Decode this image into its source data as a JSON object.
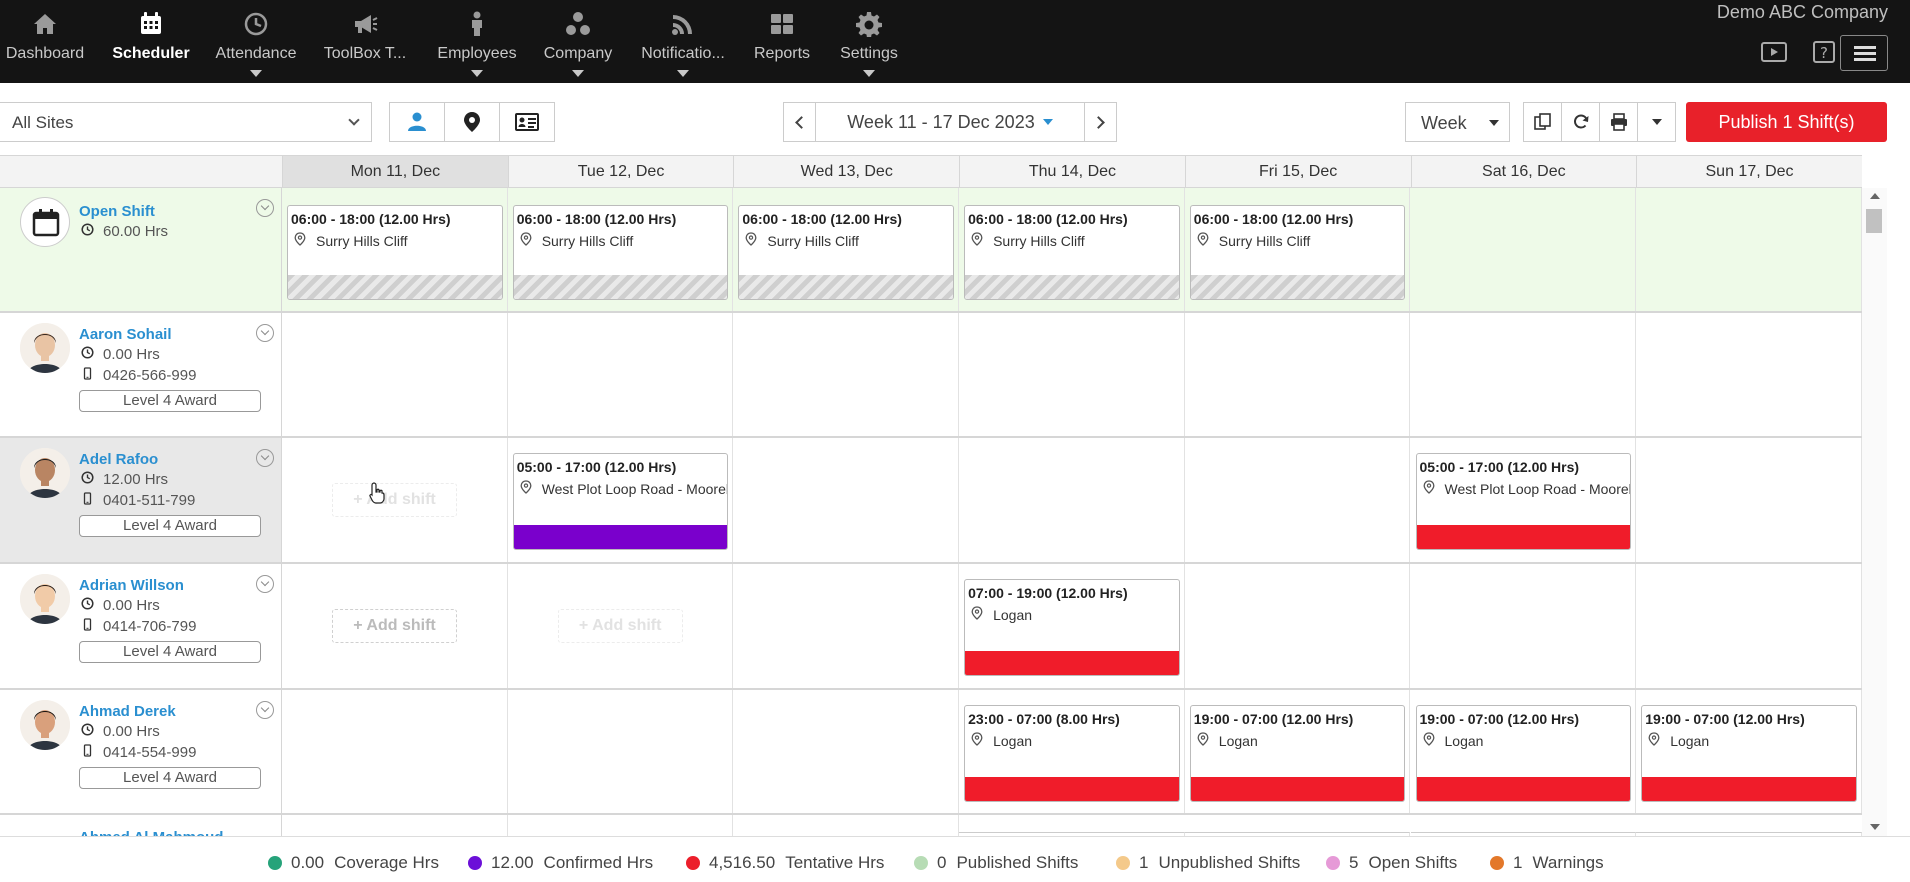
{
  "company_name": "Demo ABC Company",
  "nav": [
    {
      "label": "Dashboard",
      "icon": "home-icon",
      "active": false,
      "dropdown": false
    },
    {
      "label": "Scheduler",
      "icon": "calendar-icon",
      "active": true,
      "dropdown": false
    },
    {
      "label": "Attendance",
      "icon": "clock-icon",
      "active": false,
      "dropdown": true
    },
    {
      "label": "ToolBox T...",
      "icon": "megaphone-icon",
      "active": false,
      "dropdown": false
    },
    {
      "label": "Employees",
      "icon": "person-icon",
      "active": false,
      "dropdown": true
    },
    {
      "label": "Company",
      "icon": "group-icon",
      "active": false,
      "dropdown": true
    },
    {
      "label": "Notificatio...",
      "icon": "rss-icon",
      "active": false,
      "dropdown": true
    },
    {
      "label": "Reports",
      "icon": "grid-icon",
      "active": false,
      "dropdown": false
    },
    {
      "label": "Settings",
      "icon": "gear-icon",
      "active": false,
      "dropdown": true
    }
  ],
  "toolbar": {
    "site_filter": "All Sites",
    "week_range": "Week 11 - 17 Dec 2023",
    "view_mode": "Week",
    "publish_label": "Publish 1 Shift(s)"
  },
  "days": [
    {
      "label": "Mon 11, Dec",
      "today": true
    },
    {
      "label": "Tue 12, Dec",
      "today": false
    },
    {
      "label": "Wed 13, Dec",
      "today": false
    },
    {
      "label": "Thu 14, Dec",
      "today": false
    },
    {
      "label": "Fri 15, Dec",
      "today": false
    },
    {
      "label": "Sat 16, Dec",
      "today": false
    },
    {
      "label": "Sun 17, Dec",
      "today": false
    }
  ],
  "open_shift": {
    "name": "Open Shift",
    "hours": "60.00 Hrs",
    "shifts": [
      {
        "day": 0,
        "time": "06:00 - 18:00 (12.00 Hrs)",
        "location": "Surry Hills Cliff"
      },
      {
        "day": 1,
        "time": "06:00 - 18:00 (12.00 Hrs)",
        "location": "Surry Hills Cliff"
      },
      {
        "day": 2,
        "time": "06:00 - 18:00 (12.00 Hrs)",
        "location": "Surry Hills Cliff"
      },
      {
        "day": 3,
        "time": "06:00 - 18:00 (12.00 Hrs)",
        "location": "Surry Hills Cliff"
      },
      {
        "day": 4,
        "time": "06:00 - 18:00 (12.00 Hrs)",
        "location": "Surry Hills Cliff"
      }
    ]
  },
  "employees": [
    {
      "name": "Aaron Sohail",
      "hours": "0.00 Hrs",
      "phone": "0426-566-999",
      "award": "Level 4 Award",
      "skin": "#e9c4a4",
      "hair": "#3b2a20",
      "shifts": [],
      "add_shift": []
    },
    {
      "name": "Adel Rafoo",
      "hours": "12.00 Hrs",
      "phone": "0401-511-799",
      "award": "Level 4 Award",
      "skin": "#b98563",
      "hair": "#1d1d1d",
      "highlight": true,
      "shifts": [
        {
          "day": 1,
          "time": "05:00 - 17:00 (12.00 Hrs)",
          "location": "West Plot Loop Road - Moorebank",
          "color": "#7a00cc"
        },
        {
          "day": 5,
          "time": "05:00 - 17:00 (12.00 Hrs)",
          "location": "West Plot Loop Road - Moorebank",
          "color": "#f01c2a"
        }
      ],
      "add_shift": [
        {
          "day": 0,
          "faint": true
        }
      ]
    },
    {
      "name": "Adrian Willson",
      "hours": "0.00 Hrs",
      "phone": "0414-706-799",
      "award": "Level 4 Award",
      "skin": "#f1cba8",
      "hair": "#2a1e18",
      "shifts": [
        {
          "day": 3,
          "time": "07:00 - 19:00 (12.00 Hrs)",
          "location": "Logan",
          "color": "#f01c2a"
        }
      ],
      "add_shift": [
        {
          "day": 0,
          "faint": false
        },
        {
          "day": 1,
          "faint": true
        }
      ]
    },
    {
      "name": "Ahmad Derek",
      "hours": "0.00 Hrs",
      "phone": "0414-554-999",
      "award": "Level 4 Award",
      "skin": "#d9a07c",
      "hair": "#1c1612",
      "shifts": [
        {
          "day": 3,
          "time": "23:00 - 07:00 (8.00 Hrs)",
          "location": "Logan",
          "color": "#f01c2a"
        },
        {
          "day": 4,
          "time": "19:00 - 07:00 (12.00 Hrs)",
          "location": "Logan",
          "color": "#f01c2a"
        },
        {
          "day": 5,
          "time": "19:00 - 07:00 (12.00 Hrs)",
          "location": "Logan",
          "color": "#f01c2a"
        },
        {
          "day": 6,
          "time": "19:00 - 07:00 (12.00 Hrs)",
          "location": "Logan",
          "color": "#f01c2a"
        }
      ],
      "add_shift": []
    }
  ],
  "add_shift_label": "+ Add shift",
  "partial_next_name": "Ahmed Al Mahmoud",
  "legend": [
    {
      "value": "0.00",
      "label": "Coverage Hrs",
      "color": "#26a37a"
    },
    {
      "value": "12.00",
      "label": "Confirmed Hrs",
      "color": "#6c10d8"
    },
    {
      "value": "4,516.50",
      "label": "Tentative Hrs",
      "color": "#ec1f2b"
    },
    {
      "value": "0",
      "label": "Published Shifts",
      "color": "#b7dcb5"
    },
    {
      "value": "1",
      "label": "Unpublished Shifts",
      "color": "#f4c98a"
    },
    {
      "value": "5",
      "label": "Open Shifts",
      "color": "#e69ad7"
    },
    {
      "value": "1",
      "label": "Warnings",
      "color": "#e3782a"
    }
  ]
}
